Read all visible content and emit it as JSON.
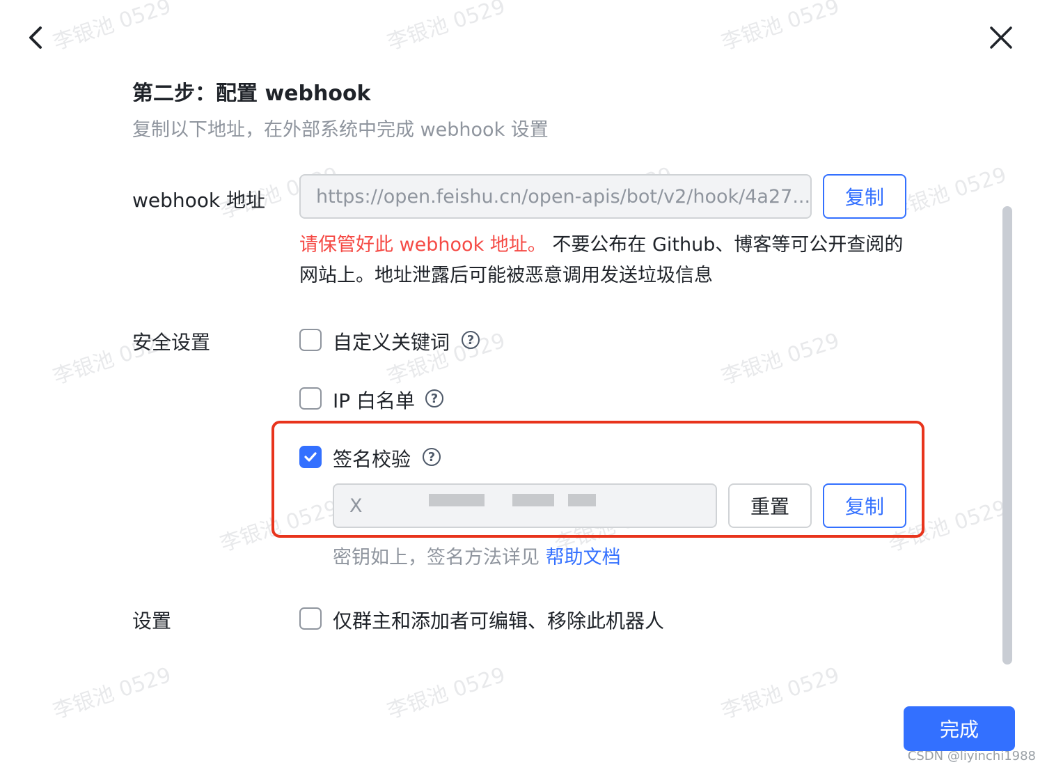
{
  "header": {
    "back_icon": "chevron-left-icon",
    "close_icon": "close-icon"
  },
  "step": {
    "title": "第二步：配置 webhook",
    "description": "复制以下地址，在外部系统中完成 webhook 设置"
  },
  "webhook": {
    "label": "webhook 地址",
    "value": "https://open.feishu.cn/open-apis/bot/v2/hook/4a27...",
    "copy_label": "复制",
    "warning_red": "请保管好此 webhook 地址。",
    "warning_rest": " 不要公布在 Github、博客等可公开查阅的网站上。地址泄露后可能被恶意调用发送垃圾信息"
  },
  "security": {
    "label": "安全设置",
    "options": [
      {
        "label": "自定义关键词",
        "checked": false
      },
      {
        "label": "IP 白名单",
        "checked": false
      },
      {
        "label": "签名校验",
        "checked": true
      }
    ],
    "secret_value": "X",
    "reset_label": "重置",
    "copy_label": "复制",
    "hint_text": "密钥如上，签名方法详见 ",
    "hint_link": "帮助文档"
  },
  "settings": {
    "label": "设置",
    "option": {
      "label": "仅群主和添加者可编辑、移除此机器人",
      "checked": false
    }
  },
  "footer": {
    "done_label": "完成"
  },
  "watermark_text": "李银池 0529",
  "credit": "CSDN @liyinchi1988",
  "colors": {
    "accent": "#3370ff",
    "danger": "#f54a45",
    "highlight": "#e8341c",
    "muted": "#8f959e"
  }
}
